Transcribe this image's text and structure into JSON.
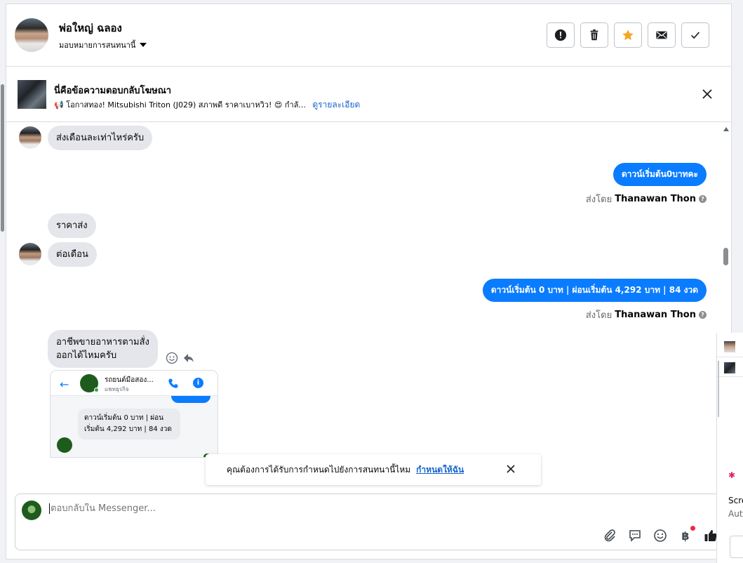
{
  "header": {
    "contact_name": "พ่อใหญ่ ฉลอง",
    "assign_label": "มอบหมายการสนทนานี้",
    "actions": [
      "report-icon",
      "trash-icon",
      "star-icon",
      "mail-icon",
      "check-icon"
    ],
    "star_color": "#f5a623"
  },
  "ad": {
    "title": "นี่คือข้อความตอบกลับโฆษณา",
    "description": "📢 โอกาสทอง! Mitsubishi Triton (J029) สภาพดี ราคาเบาหวิว! 😍 กำลั...",
    "details_link": "ดูรายละเอียด"
  },
  "messages": {
    "m1": "ส่งเดือนละเท่าไหร่ครับ",
    "m2": "ดาวน์เริ่มต้น0บาทคะ",
    "m3": "ราคาส่ง",
    "m4": "ต่อเดือน",
    "m5": "ดาวน์เริ่มต้น 0 บาท | ผ่อนเริ่มต้น 4,292 บาท | 84 งวด",
    "m6_line1": "อาชีพขายอาหารตามสั่ง",
    "m6_line2": "ออกได้ไหมครับ",
    "sent_by_label": "ส่งโดย",
    "sender_name": "Thanawan Thon"
  },
  "shared_screenshot": {
    "page_name": "รถยนต์มือสอง...",
    "page_sub": "แชทธุรกิจ",
    "bubble_text": "ดาวน์เริ่มต้น 0 บาท | ผ่อนเริ่มต้น 4,292 บาท | 84 งวด"
  },
  "toast": {
    "text": "คุณต้องการได้รับการกำหนดไปยังการสนทนานี้ไหม",
    "link": "กำหนดให้ฉัน"
  },
  "composer": {
    "placeholder": "ตอบกลับใน Messenger...",
    "tools": [
      "paperclip-icon",
      "chat-bubble-icon",
      "emoji-icon",
      "baht-icon",
      "thumbs-up-icon"
    ],
    "baht_symbol": "฿"
  },
  "right_panel": {
    "text1": "Scre",
    "text2": "Aut"
  },
  "colors": {
    "outgoing_bubble": "#0a7cff",
    "incoming_bubble": "#e4e6eb",
    "link": "#1763cf"
  }
}
